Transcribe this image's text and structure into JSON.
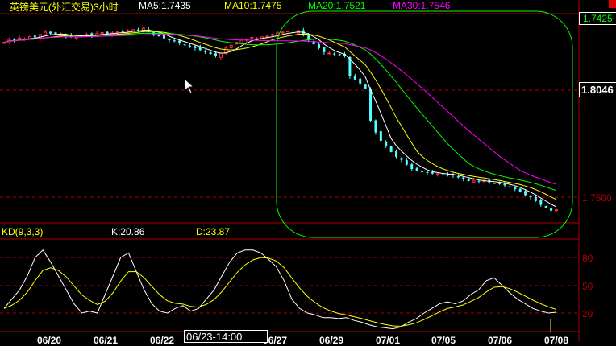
{
  "header": {
    "title": "英镑美元(外汇交易)3小时",
    "ma5": "MA5:1.7435",
    "ma10": "MA10:1.7475",
    "ma20": "MA20:1.7521",
    "ma30": "MA30:1.7546"
  },
  "price_axis": {
    "current_price": "1.7425",
    "cursor_price": "1.8046",
    "grid_label": "1.7500"
  },
  "kd_panel": {
    "title": "KD(9,3,3)",
    "k_label": "K:20.86",
    "d_label": "D:23.87",
    "axis_labels": [
      "80",
      "50",
      "20"
    ]
  },
  "x_axis": {
    "dates": [
      "06/20",
      "06/21",
      "06/22",
      "06/27",
      "06/29",
      "07/01",
      "07/05",
      "07/06",
      "07/08"
    ],
    "cursor_label": "06/23-14:00"
  },
  "colors": {
    "up": "#ff3232",
    "down": "#54ffff",
    "ma5": "#ffffff",
    "ma10": "#ffff00",
    "ma20": "#00ff00",
    "ma30": "#ff00ff",
    "grid": "#b00000",
    "highlight": "#00ff00"
  },
  "chart_data": [
    {
      "type": "candlestick",
      "title": "英镑美元(外汇交易)3小时",
      "ylabel_ticks": [
        "1.8046",
        "1.7500"
      ],
      "moving_averages": [
        5,
        10,
        20,
        30
      ],
      "closes": [
        1.829,
        1.8305,
        1.8298,
        1.8312,
        1.8308,
        1.832,
        1.8315,
        1.833,
        1.8342,
        1.8335,
        1.8328,
        1.833,
        1.8322,
        1.8318,
        1.8325,
        1.8321,
        1.833,
        1.8325,
        1.8335,
        1.834,
        1.8332,
        1.8338,
        1.8345,
        1.8342,
        1.835,
        1.8355,
        1.8348,
        1.8362,
        1.8345,
        1.833,
        1.8321,
        1.831,
        1.83,
        1.8295,
        1.8285,
        1.8275,
        1.8268,
        1.826,
        1.825,
        1.824,
        1.823,
        1.8219,
        1.8235,
        1.826,
        1.8275,
        1.829,
        1.8301,
        1.8305,
        1.8315,
        1.831,
        1.8318,
        1.8321,
        1.833,
        1.8338,
        1.8342,
        1.8348,
        1.834,
        1.835,
        1.8325,
        1.8301,
        1.828,
        1.826,
        1.8239,
        1.8235,
        1.8228,
        1.8225,
        1.8219,
        1.8116,
        1.81,
        1.808,
        1.8054,
        1.789,
        1.783,
        1.7787,
        1.776,
        1.773,
        1.7705,
        1.769,
        1.7665,
        1.7643,
        1.7635,
        1.7628,
        1.7623,
        1.762,
        1.7618,
        1.7615,
        1.7612,
        1.761,
        1.76,
        1.759,
        1.7582,
        1.7585,
        1.758,
        1.7582,
        1.7575,
        1.757,
        1.7569,
        1.756,
        1.755,
        1.754,
        1.7525,
        1.751,
        1.75,
        1.748,
        1.746,
        1.7445,
        1.743,
        1.7435
      ]
    },
    {
      "type": "line",
      "title": "KD(9,3,3)",
      "ylim": [
        0,
        100
      ],
      "yticks": [
        20,
        50,
        80
      ],
      "series": [
        {
          "name": "K",
          "values": [
            25,
            35,
            45,
            60,
            80,
            88,
            75,
            60,
            45,
            30,
            20,
            22,
            20,
            40,
            60,
            80,
            85,
            65,
            45,
            30,
            22,
            20,
            25,
            28,
            22,
            25,
            35,
            45,
            60,
            75,
            85,
            88,
            88,
            85,
            78,
            70,
            55,
            35,
            25,
            20,
            18,
            15,
            15,
            14,
            15,
            12,
            10,
            7,
            5,
            4,
            3,
            5,
            10,
            14,
            20,
            25,
            30,
            32,
            30,
            33,
            40,
            45,
            55,
            58,
            50,
            42,
            35,
            30,
            25,
            22,
            20,
            20.86
          ]
        },
        {
          "name": "D",
          "values": [
            23.87
          ]
        }
      ]
    }
  ]
}
